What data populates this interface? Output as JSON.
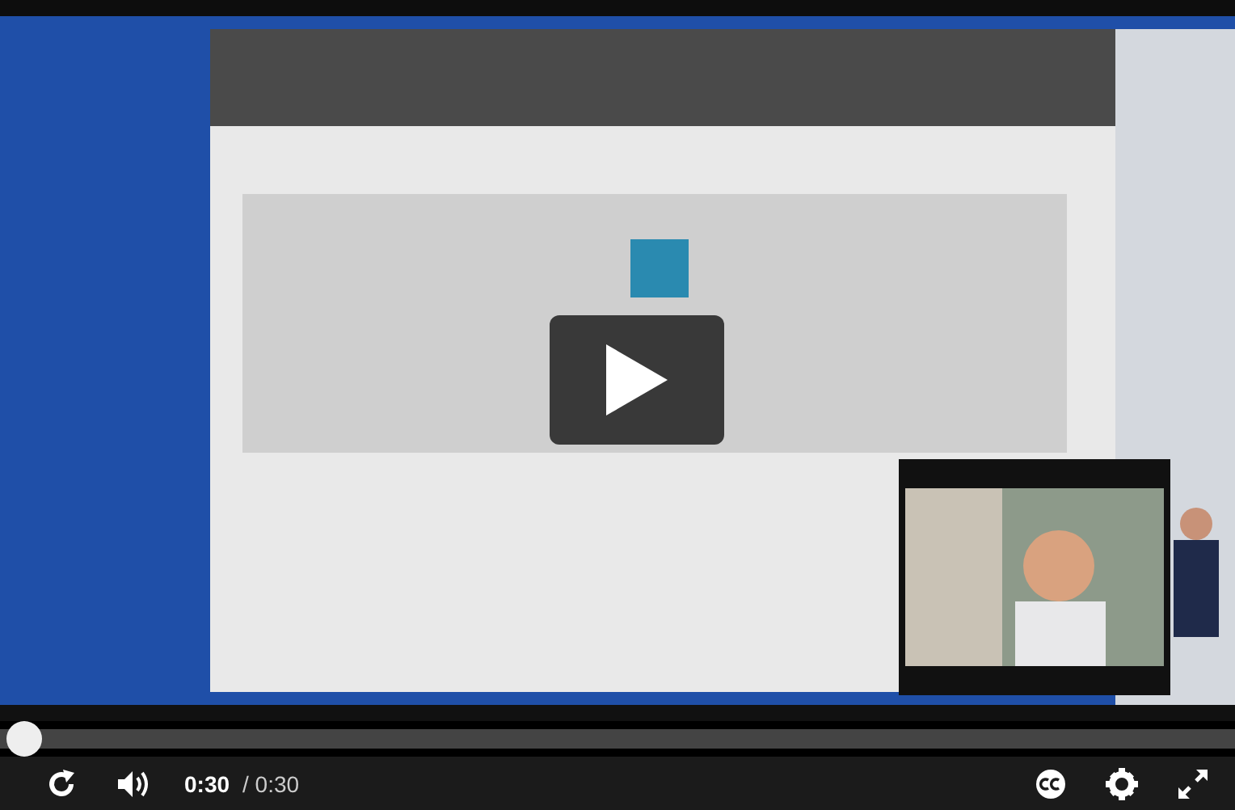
{
  "progress": {
    "level": 0
  },
  "controls": {
    "current_time": "0:30",
    "duration": "/ 0:30"
  }
}
